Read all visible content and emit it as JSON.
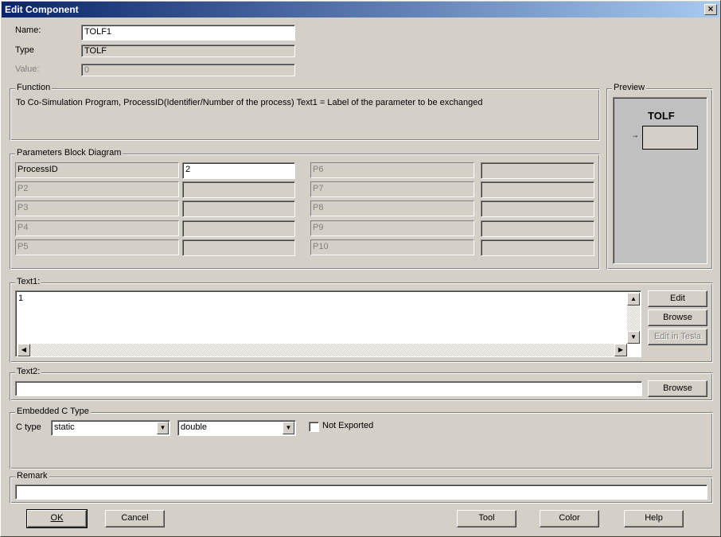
{
  "window": {
    "title": "Edit Component",
    "close_glyph": "×"
  },
  "fields": {
    "name_label": "Name:",
    "name_value": "TOLF1",
    "type_label": "Type",
    "type_value": "TOLF",
    "value_label": "Value:",
    "value_value": "0"
  },
  "function": {
    "title": "Function",
    "text": "To Co-Simulation Program, ProcessID(Identifier/Number of the process) Text1 = Label of the parameter to be exchanged"
  },
  "preview": {
    "title": "Preview",
    "component_label": "TOLF",
    "pin_glyph": "→"
  },
  "params": {
    "title": "Parameters Block Diagram",
    "left": [
      {
        "label": "ProcessID",
        "value": "2"
      },
      {
        "label": "P2",
        "value": ""
      },
      {
        "label": "P3",
        "value": ""
      },
      {
        "label": "P4",
        "value": ""
      },
      {
        "label": "P5",
        "value": ""
      }
    ],
    "right": [
      {
        "label": "P6",
        "value": ""
      },
      {
        "label": "P7",
        "value": ""
      },
      {
        "label": "P8",
        "value": ""
      },
      {
        "label": "P9",
        "value": ""
      },
      {
        "label": "P10",
        "value": ""
      }
    ]
  },
  "text1": {
    "title": "Text1:",
    "content": "1",
    "edit_label": "Edit",
    "browse_label": "Browse",
    "tesla_label": "Edit in Tesla"
  },
  "text2": {
    "title": "Text2:",
    "value": "",
    "browse_label": "Browse"
  },
  "embedded": {
    "title": "Embedded C Type",
    "ctype_label": "C type",
    "ctype_value": "static",
    "datatype_value": "double",
    "not_exported_label": "Not Exported",
    "not_exported_checked": false
  },
  "remark": {
    "title": "Remark",
    "value": ""
  },
  "footer": {
    "ok_label": "OK",
    "cancel_label": "Cancel",
    "tool_label": "Tool",
    "color_label": "Color",
    "help_label": "Help"
  }
}
